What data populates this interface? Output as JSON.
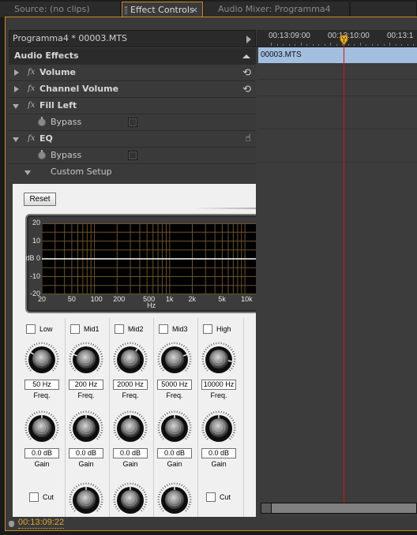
{
  "tabs": [
    {
      "label": "Source: (no clips)",
      "active": false
    },
    {
      "label": "Effect Controls",
      "active": true,
      "close": "×"
    },
    {
      "label": "Audio Mixer: Programma4",
      "active": false
    }
  ],
  "clip_header": {
    "label": "Programma4 * 00003.MTS"
  },
  "effects": {
    "section_label": "Audio Effects",
    "items": [
      {
        "label": "Volume",
        "expanded": false,
        "icon": "reset-icon"
      },
      {
        "label": "Channel Volume",
        "expanded": false,
        "icon": "reset-icon"
      },
      {
        "label": "Fill Left",
        "expanded": true,
        "bypass_label": "Bypass"
      },
      {
        "label": "EQ",
        "expanded": true,
        "bypass_label": "Bypass",
        "icon": "hand-icon"
      }
    ],
    "custom_setup_label": "Custom Setup",
    "fx_glyph": "fx"
  },
  "eq": {
    "reset_label": "Reset",
    "graph": {
      "y_ticks": [
        "20",
        "10",
        "dB 0",
        "-10",
        "-20"
      ],
      "x_ticks": [
        "20",
        "50",
        "100",
        "200",
        "500",
        "1k",
        "2k",
        "5k",
        "10k"
      ],
      "x_unit": "Hz",
      "gain_curve_db": 0,
      "line_color": "#ffffff",
      "grid_color": "#6b5324"
    },
    "bands": [
      {
        "label": "Low",
        "enabled": false,
        "freq": "50 Hz",
        "gain": "0.0 dB",
        "cut_label": "Cut",
        "has_cut": true
      },
      {
        "label": "Mid1",
        "enabled": false,
        "freq": "200 Hz",
        "gain": "0.0 dB"
      },
      {
        "label": "Mid2",
        "enabled": false,
        "freq": "2000 Hz",
        "gain": "0.0 dB"
      },
      {
        "label": "Mid3",
        "enabled": false,
        "freq": "5000 Hz",
        "gain": "0.0 dB"
      },
      {
        "label": "High",
        "enabled": false,
        "freq": "10000 Hz",
        "gain": "0.0 dB",
        "cut_label": "Cut",
        "has_cut": true
      }
    ],
    "freq_caption": "Freq.",
    "gain_caption": "Gain"
  },
  "timeline": {
    "ruler_labels": [
      "00:13:09:00",
      "00:13:10:00",
      "00:13:1"
    ],
    "clip_name": "00003.MTS"
  },
  "status": {
    "timecode": "00:13:09:22"
  },
  "colors": {
    "accent": "#c88d14",
    "timecode": "#e1a62b",
    "playhead": "#dd1111",
    "clip": "#a3bfdf"
  }
}
